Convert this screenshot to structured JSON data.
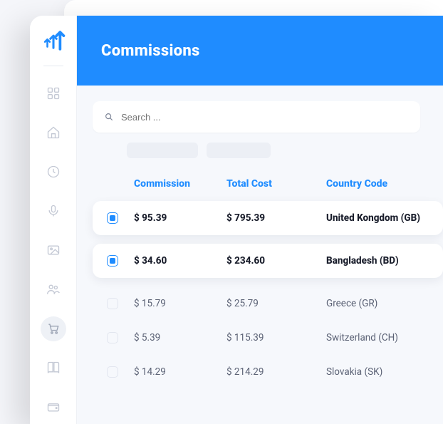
{
  "header": {
    "title": "Commissions"
  },
  "search": {
    "placeholder": "Search ..."
  },
  "columns": {
    "commission": "Commission",
    "total_cost": "Total Cost",
    "country_code": "Country Code"
  },
  "rows": [
    {
      "checked": true,
      "commission": "$ 95.39",
      "total_cost": "$ 795.39",
      "country": "United Kongdom (GB)"
    },
    {
      "checked": true,
      "commission": "$ 34.60",
      "total_cost": "$ 234.60",
      "country": "Bangladesh (BD)"
    },
    {
      "checked": false,
      "commission": "$ 15.79",
      "total_cost": "$ 25.79",
      "country": "Greece (GR)"
    },
    {
      "checked": false,
      "commission": "$ 5.39",
      "total_cost": "$ 115.39",
      "country": "Switzerland (CH)"
    },
    {
      "checked": false,
      "commission": "$ 14.29",
      "total_cost": "$ 214.29",
      "country": "Slovakia (SK)"
    }
  ],
  "sidebar": {
    "items": [
      {
        "name": "dashboard",
        "active": false
      },
      {
        "name": "home",
        "active": false
      },
      {
        "name": "time",
        "active": false
      },
      {
        "name": "mic",
        "active": false
      },
      {
        "name": "image",
        "active": false
      },
      {
        "name": "users",
        "active": false
      },
      {
        "name": "cart",
        "active": true
      },
      {
        "name": "book",
        "active": false
      },
      {
        "name": "wallet",
        "active": false
      }
    ]
  }
}
